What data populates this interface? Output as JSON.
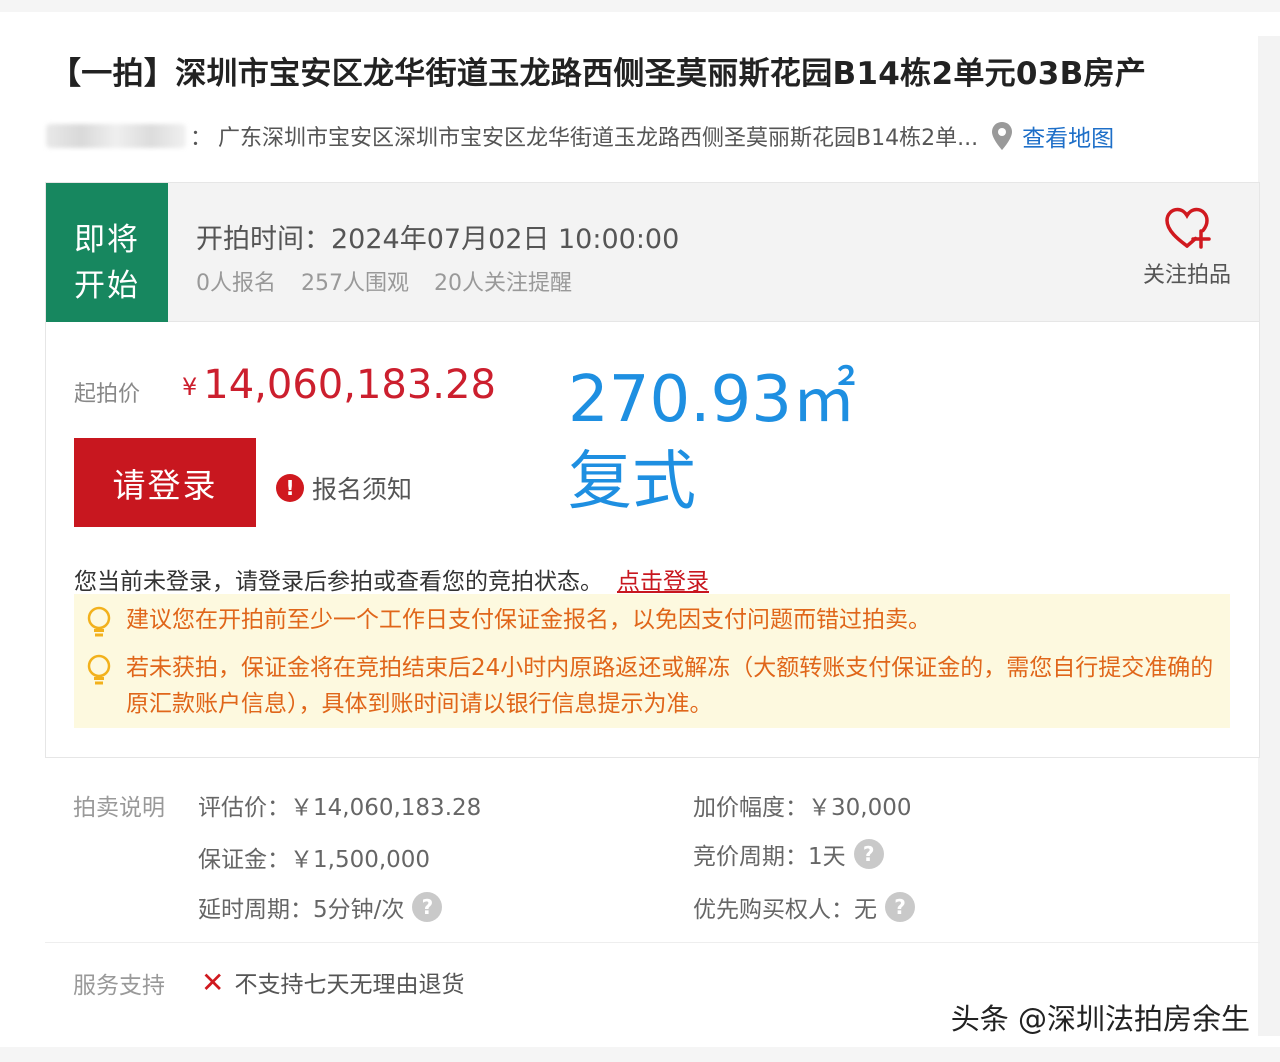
{
  "listing": {
    "title": "【一拍】深圳市宝安区龙华街道玉龙路西侧圣莫丽斯花园B14栋2单元03B房产",
    "address_colon": "：",
    "address": "广东深圳市宝安区深圳市宝安区龙华街道玉龙路西侧圣莫丽斯花园B14栋2单...",
    "map_link": "查看地图"
  },
  "status": {
    "tag": "即将开始",
    "tag_line1": "即将",
    "tag_line2": "开始",
    "start_time": "开拍时间：2024年07月02日 10:00:00",
    "signups": "0人报名",
    "views": "257人围观",
    "reminders": "20人关注提醒",
    "follow_label": "关注拍品"
  },
  "price": {
    "label": "起拍价",
    "currency": "¥",
    "amount": "14,060,183.28",
    "area": "270.93㎡",
    "type": "复式",
    "login_button": "请登录",
    "notice": "报名须知",
    "login_status": "您当前未登录，请登录后参拍或查看您的竞拍状态。",
    "login_link": "点击登录",
    "tips": [
      "建议您在开拍前至少一个工作日支付保证金报名，以免因支付问题而错过拍卖。",
      "若未获拍，保证金将在竞拍结束后24小时内原路返还或解冻（大额转账支付保证金的，需您自行提交准确的原汇款账户信息），具体到账时间请以银行信息提示为准。"
    ]
  },
  "auction_info": {
    "label": "拍卖说明",
    "appraisal": "评估价：￥14,060,183.28",
    "increment": "加价幅度：￥30,000",
    "deposit": "保证金：￥1,500,000",
    "bid_period": "竞价周期：1天",
    "extension": "延时周期：5分钟/次",
    "priority": "优先购买权人：无"
  },
  "service": {
    "label": "服务支持",
    "item": "不支持七天无理由退货"
  },
  "watermark": "头条 @深圳法拍房余生",
  "colors": {
    "status_green": "#17875f",
    "price_red": "#cc1f2e",
    "area_blue": "#1e8fe1",
    "link_blue": "#1e6fc8",
    "tip_orange": "#e0661a",
    "tip_bg": "#fdf9df"
  }
}
